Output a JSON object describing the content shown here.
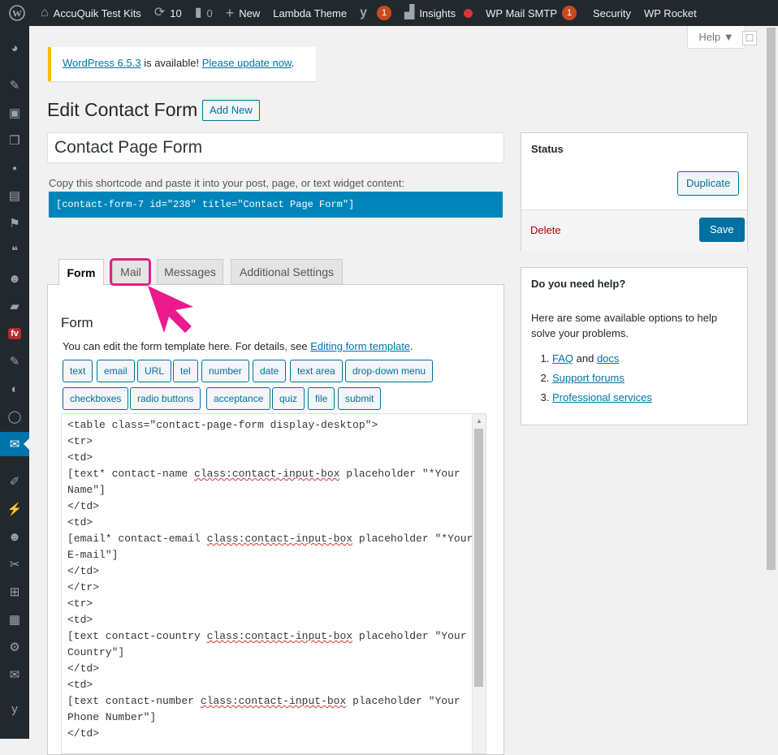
{
  "admin_bar": {
    "site_name": "AccuQuik Test Kits",
    "updates_count": "10",
    "comments_count": "0",
    "new_label": "New",
    "theme_label": "Lambda Theme",
    "yoast_count": "1",
    "insights_label": "Insights",
    "smtp_label": "WP Mail SMTP",
    "smtp_count": "1",
    "security_label": "Security",
    "rocket_label": "WP Rocket"
  },
  "sidebar": {
    "icons": [
      "dashboard-icon",
      "pin-icon",
      "media-icon",
      "pages-icon",
      "comments-icon",
      "slider-icon",
      "feedback-icon",
      "testimonials-icon",
      "users-group-icon",
      "folder-icon",
      "fv-icon",
      "pin-icon",
      "portfolio-icon",
      "circle-icon",
      "contact-mail-icon",
      "appearance-icon",
      "plugins-icon",
      "users-icon",
      "tools-icon",
      "add-block-icon",
      "settings-table-icon",
      "settings-icon",
      "mail-smtp-icon",
      "yoast-icon"
    ],
    "fv_label": "fv"
  },
  "help": {
    "label": "Help ▼"
  },
  "notice": {
    "version_link": "WordPress 6.5.3",
    "middle_text": " is available! ",
    "update_link": "Please update now",
    "end_text": "."
  },
  "page": {
    "title": "Edit Contact Form",
    "add_new_label": "Add New",
    "form_title_value": "Contact Page Form",
    "shortcode_label": "Copy this shortcode and paste it into your post, page, or text widget content:",
    "shortcode": "[contact-form-7 id=\"238\" title=\"Contact Page Form\"]"
  },
  "tabs": [
    {
      "label": "Form"
    },
    {
      "label": "Mail"
    },
    {
      "label": "Messages"
    },
    {
      "label": "Additional Settings"
    }
  ],
  "form_panel": {
    "heading": "Form",
    "desc_text": "You can edit the form template here. For details, see ",
    "desc_link": "Editing form template",
    "desc_end": ".",
    "tag_buttons_row1": [
      "text",
      "email",
      "URL",
      "tel",
      "number",
      "date",
      "text area",
      "drop-down menu"
    ],
    "tag_buttons_row2": [
      "checkboxes",
      "radio buttons",
      "acceptance",
      "quiz",
      "file",
      "submit"
    ]
  },
  "editor": {
    "lines": [
      "<table class=\"contact-page-form display-desktop\">",
      "<tr>",
      "<td>",
      "[text* contact-name class:contact-input-box placeholder \"*Your",
      "Name\"]",
      "</td>",
      "<td>",
      "[email* contact-email class:contact-input-box placeholder \"*Your",
      "E-mail\"]",
      "</td>",
      "</tr>",
      "<tr>",
      "<td>",
      "[text contact-country class:contact-input-box placeholder \"Your",
      "Country\"]",
      "</td>",
      "<td>",
      "[text contact-number class:contact-input-box placeholder \"Your",
      "Phone Number\"]",
      "</td>"
    ]
  },
  "status_box": {
    "title": "Status",
    "duplicate_label": "Duplicate",
    "delete_label": "Delete",
    "save_label": "Save"
  },
  "help_box": {
    "title": "Do you need help?",
    "text": "Here are some available options to help solve your problems.",
    "faq": "FAQ",
    "and": " and ",
    "docs": "docs",
    "forums": "Support forums",
    "services": "Professional services"
  },
  "colors": {
    "admin_bar": "#23282d",
    "accent": "#0073aa",
    "shortcode_bg": "#0085ba",
    "highlight": "#e0208a",
    "notice_border": "#ffb900",
    "badge": "#ca4a1f"
  }
}
